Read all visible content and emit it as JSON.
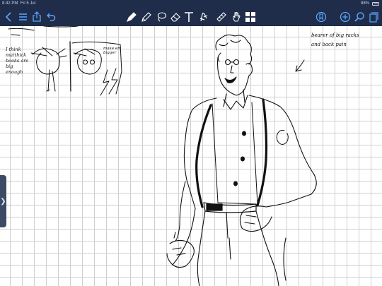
{
  "status": {
    "time": "8:42 PM",
    "date": "Fri 5 Jul",
    "battery": "88%"
  },
  "toolbar": {
    "left": [
      "back-icon",
      "list-icon",
      "share-icon",
      "undo-icon"
    ],
    "tools": [
      "pen-icon",
      "pencil-icon",
      "lasso-icon",
      "ruler-icon",
      "text-icon",
      "shape-icon",
      "highlighter-icon",
      "hand-icon",
      "grid-icon"
    ],
    "right": [
      "bookmark-icon",
      "add-icon",
      "search-icon",
      "pages-icon"
    ],
    "colors": {
      "bar": "#1f2d4a",
      "icon": "#ffffff",
      "accent": "#5aa7ff"
    }
  },
  "canvas": {
    "notes": {
      "left": "I think\nmatthick\nbooks are\nbig enough",
      "small": "make em\nbigger",
      "right": "bearer of big racks\nand back pain"
    }
  }
}
